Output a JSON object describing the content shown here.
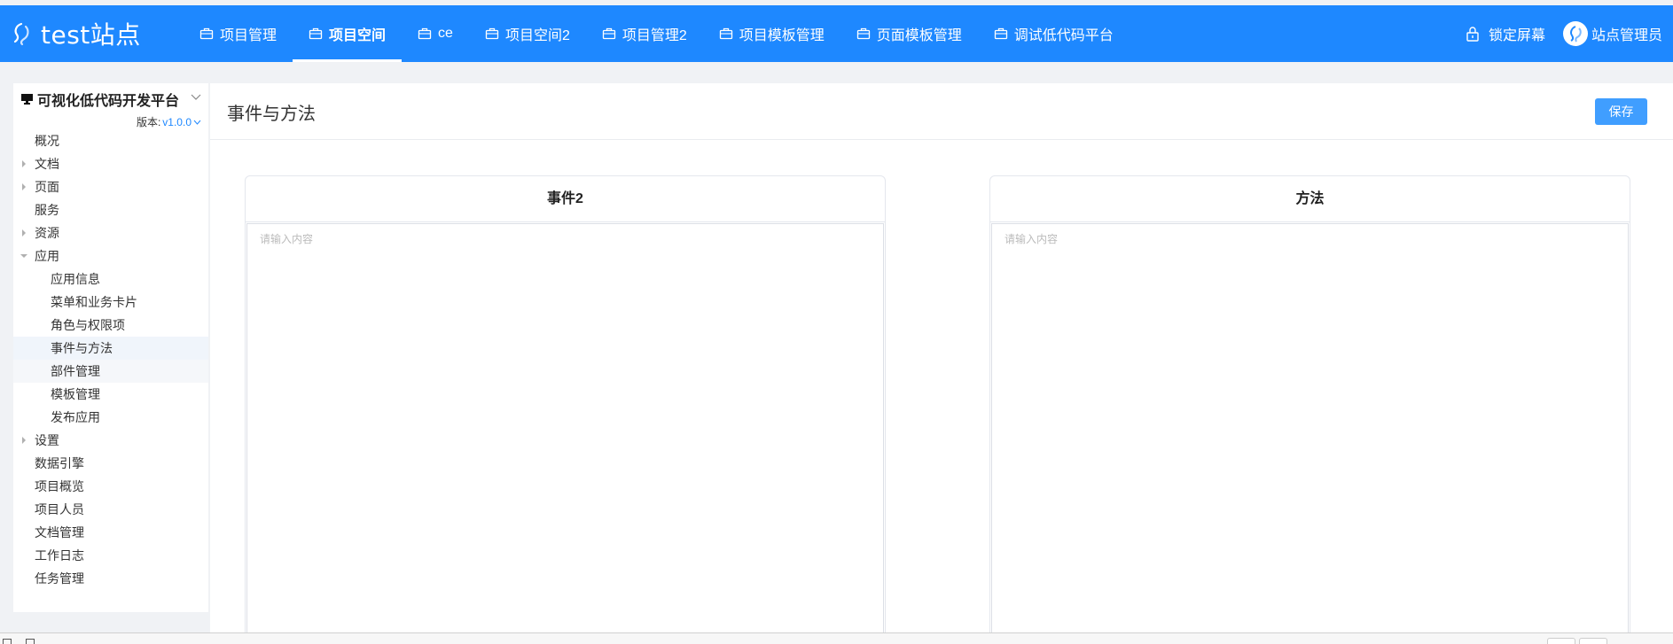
{
  "app": {
    "brand": "test站点"
  },
  "topnav": [
    {
      "label": "项目管理"
    },
    {
      "label": "项目空间",
      "active": true
    },
    {
      "label": "ce"
    },
    {
      "label": "项目空间2"
    },
    {
      "label": "项目管理2"
    },
    {
      "label": "项目模板管理"
    },
    {
      "label": "页面模板管理"
    },
    {
      "label": "调试低代码平台"
    }
  ],
  "topright": {
    "lock_label": "锁定屏幕",
    "user_label": "站点管理员"
  },
  "sidebar": {
    "title": "可视化低代码开发平台",
    "version_label": "版本:",
    "version_value": "v1.0.0",
    "items": [
      {
        "label": "概况",
        "level": 0,
        "caret": false
      },
      {
        "label": "文档",
        "level": 0,
        "caret": "right"
      },
      {
        "label": "页面",
        "level": 0,
        "caret": "right"
      },
      {
        "label": "服务",
        "level": 0,
        "caret": false
      },
      {
        "label": "资源",
        "level": 0,
        "caret": "right"
      },
      {
        "label": "应用",
        "level": 0,
        "caret": "down"
      },
      {
        "label": "应用信息",
        "level": 1,
        "caret": false
      },
      {
        "label": "菜单和业务卡片",
        "level": 1,
        "caret": false
      },
      {
        "label": "角色与权限项",
        "level": 1,
        "caret": false
      },
      {
        "label": "事件与方法",
        "level": 1,
        "caret": false,
        "active": true
      },
      {
        "label": "部件管理",
        "level": 1,
        "caret": false,
        "hover": true
      },
      {
        "label": "模板管理",
        "level": 1,
        "caret": false
      },
      {
        "label": "发布应用",
        "level": 1,
        "caret": false
      },
      {
        "label": "设置",
        "level": 0,
        "caret": "right"
      },
      {
        "label": "数据引擎",
        "level": 0,
        "caret": false
      },
      {
        "label": "项目概览",
        "level": 0,
        "caret": false
      },
      {
        "label": "项目人员",
        "level": 0,
        "caret": false
      },
      {
        "label": "文档管理",
        "level": 0,
        "caret": false
      },
      {
        "label": "工作日志",
        "level": 0,
        "caret": false
      },
      {
        "label": "任务管理",
        "level": 0,
        "caret": false
      }
    ]
  },
  "main": {
    "title": "事件与方法",
    "save_label": "保存",
    "events_panel": {
      "title": "事件2",
      "placeholder": "请输入内容",
      "value": ""
    },
    "methods_panel": {
      "title": "方法",
      "placeholder": "请输入内容",
      "value": ""
    }
  },
  "colors": {
    "topbar": "#1e88ff",
    "accent": "#409eff",
    "version": "#1e88ff"
  }
}
